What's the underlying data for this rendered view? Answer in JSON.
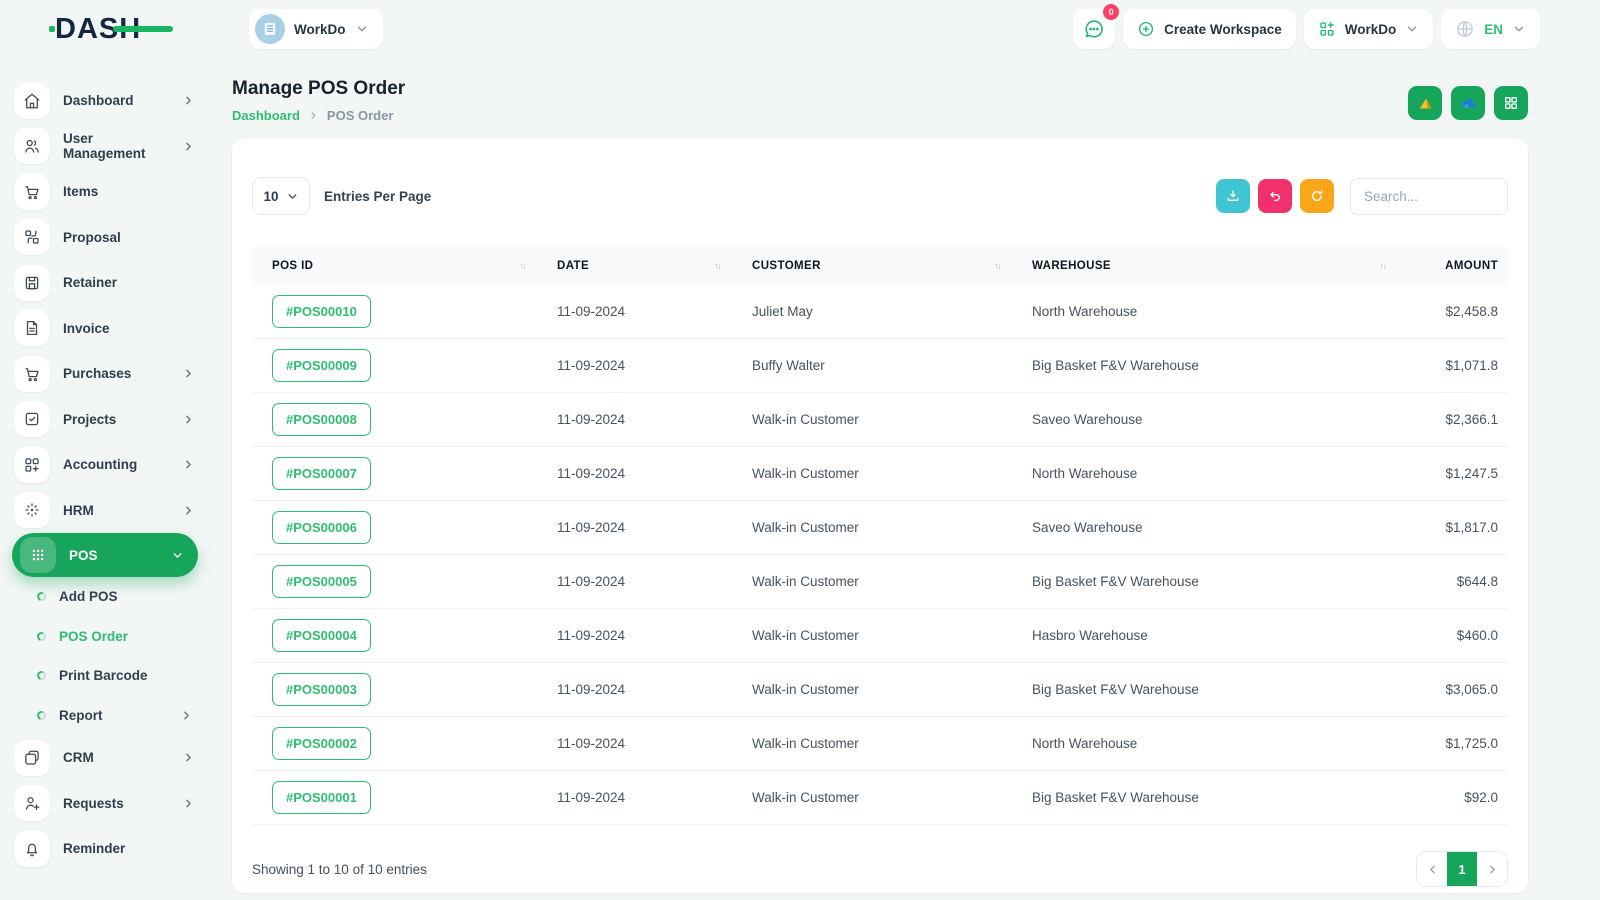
{
  "colors": {
    "primary_green": "#17a55c",
    "link_green": "#2fbe71",
    "teal": "#3fc5d2",
    "pink": "#f1316d",
    "orange": "#f9a61a",
    "badge_red": "#ff4066",
    "onedrive_blue": "#1b7fd4",
    "drive_yellow": "#f6b51e"
  },
  "topbar": {
    "logo_text": "DASH",
    "workspace_selector": {
      "label": "WorkDo",
      "icon": "building-avatar"
    },
    "messages": {
      "icon": "chat-icon",
      "badge": "0"
    },
    "create_workspace": {
      "label": "Create Workspace",
      "icon": "plus-circle-icon"
    },
    "workspace_dropdown": {
      "label": "WorkDo",
      "icon": "grid-plus-icon"
    },
    "language": {
      "label": "EN",
      "icon": "globe-icon"
    }
  },
  "sidebar": {
    "items": [
      {
        "label": "Dashboard",
        "icon": "home-icon",
        "chevron": true
      },
      {
        "label": "User Management",
        "icon": "users-icon",
        "chevron": true
      },
      {
        "label": "Items",
        "icon": "cart-icon",
        "chevron": false
      },
      {
        "label": "Proposal",
        "icon": "proposal-icon",
        "chevron": false
      },
      {
        "label": "Retainer",
        "icon": "retainer-icon",
        "chevron": false
      },
      {
        "label": "Invoice",
        "icon": "invoice-icon",
        "chevron": false
      },
      {
        "label": "Purchases",
        "icon": "cart-icon",
        "chevron": true
      },
      {
        "label": "Projects",
        "icon": "check-square-icon",
        "chevron": true
      },
      {
        "label": "Accounting",
        "icon": "grid-plus-icon",
        "chevron": true
      },
      {
        "label": "HRM",
        "icon": "crosshair-icon",
        "chevron": true
      },
      {
        "label": "POS",
        "icon": "dots-grid-icon",
        "chevron": true,
        "active": true
      }
    ],
    "pos_subitems": [
      {
        "label": "Add POS",
        "active": false
      },
      {
        "label": "POS Order",
        "active": true
      },
      {
        "label": "Print Barcode",
        "active": false
      },
      {
        "label": "Report",
        "active": false,
        "chevron": true
      }
    ],
    "items_after": [
      {
        "label": "CRM",
        "icon": "crm-icon",
        "chevron": true
      },
      {
        "label": "Requests",
        "icon": "user-plus-icon",
        "chevron": true
      },
      {
        "label": "Reminder",
        "icon": "bell-icon",
        "chevron": false
      }
    ]
  },
  "page": {
    "title": "Manage POS Order",
    "breadcrumb": {
      "home": "Dashboard",
      "current": "POS Order"
    },
    "head_actions": [
      {
        "icon": "drive-icon"
      },
      {
        "icon": "cloud-icon"
      },
      {
        "icon": "grid-icon"
      }
    ]
  },
  "table": {
    "per_page_value": "10",
    "per_page_label": "Entries Per Page",
    "action_icons": [
      "download-icon",
      "undo-icon",
      "refresh-icon"
    ],
    "search_placeholder": "Search...",
    "columns": [
      "POS ID",
      "DATE",
      "CUSTOMER",
      "WAREHOUSE",
      "AMOUNT"
    ],
    "rows": [
      {
        "pos_id": "#POS00010",
        "date": "11-09-2024",
        "customer": "Juliet May",
        "warehouse": "North Warehouse",
        "amount": "$2,458.8"
      },
      {
        "pos_id": "#POS00009",
        "date": "11-09-2024",
        "customer": "Buffy Walter",
        "warehouse": "Big Basket F&V Warehouse",
        "amount": "$1,071.8"
      },
      {
        "pos_id": "#POS00008",
        "date": "11-09-2024",
        "customer": "Walk-in Customer",
        "warehouse": "Saveo Warehouse",
        "amount": "$2,366.1"
      },
      {
        "pos_id": "#POS00007",
        "date": "11-09-2024",
        "customer": "Walk-in Customer",
        "warehouse": "North Warehouse",
        "amount": "$1,247.5"
      },
      {
        "pos_id": "#POS00006",
        "date": "11-09-2024",
        "customer": "Walk-in Customer",
        "warehouse": "Saveo Warehouse",
        "amount": "$1,817.0"
      },
      {
        "pos_id": "#POS00005",
        "date": "11-09-2024",
        "customer": "Walk-in Customer",
        "warehouse": "Big Basket F&V Warehouse",
        "amount": "$644.8"
      },
      {
        "pos_id": "#POS00004",
        "date": "11-09-2024",
        "customer": "Walk-in Customer",
        "warehouse": "Hasbro Warehouse",
        "amount": "$460.0"
      },
      {
        "pos_id": "#POS00003",
        "date": "11-09-2024",
        "customer": "Walk-in Customer",
        "warehouse": "Big Basket F&V Warehouse",
        "amount": "$3,065.0"
      },
      {
        "pos_id": "#POS00002",
        "date": "11-09-2024",
        "customer": "Walk-in Customer",
        "warehouse": "North Warehouse",
        "amount": "$1,725.0"
      },
      {
        "pos_id": "#POS00001",
        "date": "11-09-2024",
        "customer": "Walk-in Customer",
        "warehouse": "Big Basket F&V Warehouse",
        "amount": "$92.0"
      }
    ],
    "footer": {
      "showing_text": "Showing 1 to 10 of 10 entries",
      "page": "1"
    }
  }
}
